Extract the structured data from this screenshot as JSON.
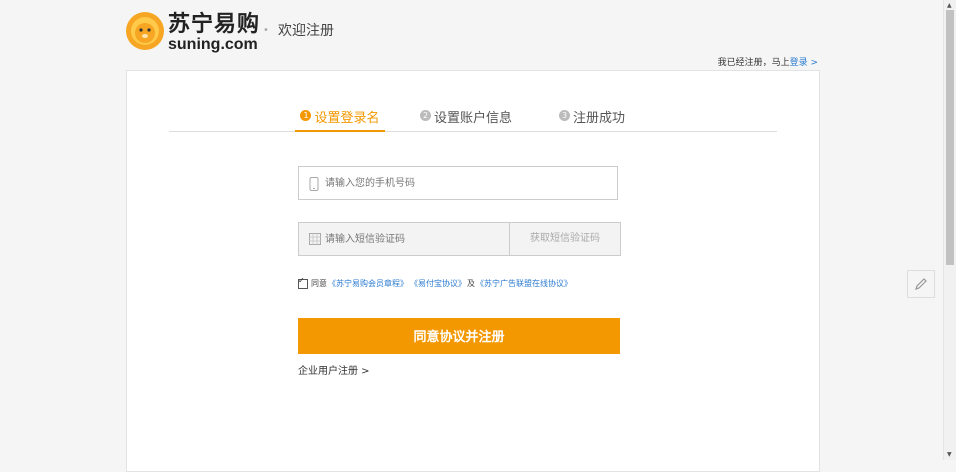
{
  "header": {
    "logo_cn": "苏宁易购",
    "logo_en": "suning.com",
    "welcome": "欢迎注册",
    "login_prompt": "我已经注册，马上",
    "login_link": "登录 >"
  },
  "steps": [
    {
      "num": "1",
      "label": "设置登录名"
    },
    {
      "num": "2",
      "label": "设置账户信息"
    },
    {
      "num": "3",
      "label": "注册成功"
    }
  ],
  "form": {
    "phone_placeholder": "请输入您的手机号码",
    "code_placeholder": "请输入短信验证码",
    "get_code": "获取短信验证码",
    "agree_prefix": "同意",
    "agree_link1": "《苏宁易购会员章程》",
    "agree_link2": "《易付宝协议》",
    "agree_mid": "及",
    "agree_link3": "《苏宁广告联盟在线协议》",
    "submit": "同意协议并注册",
    "enterprise": "企业用户注册 >"
  },
  "colors": {
    "accent": "#f39800",
    "link": "#2b7bd0"
  },
  "icons": {
    "logo": "lion-logo-icon",
    "phone": "mobile-phone-icon",
    "code": "keypad-icon",
    "float": "pencil-icon",
    "dot": "dot-separator"
  }
}
